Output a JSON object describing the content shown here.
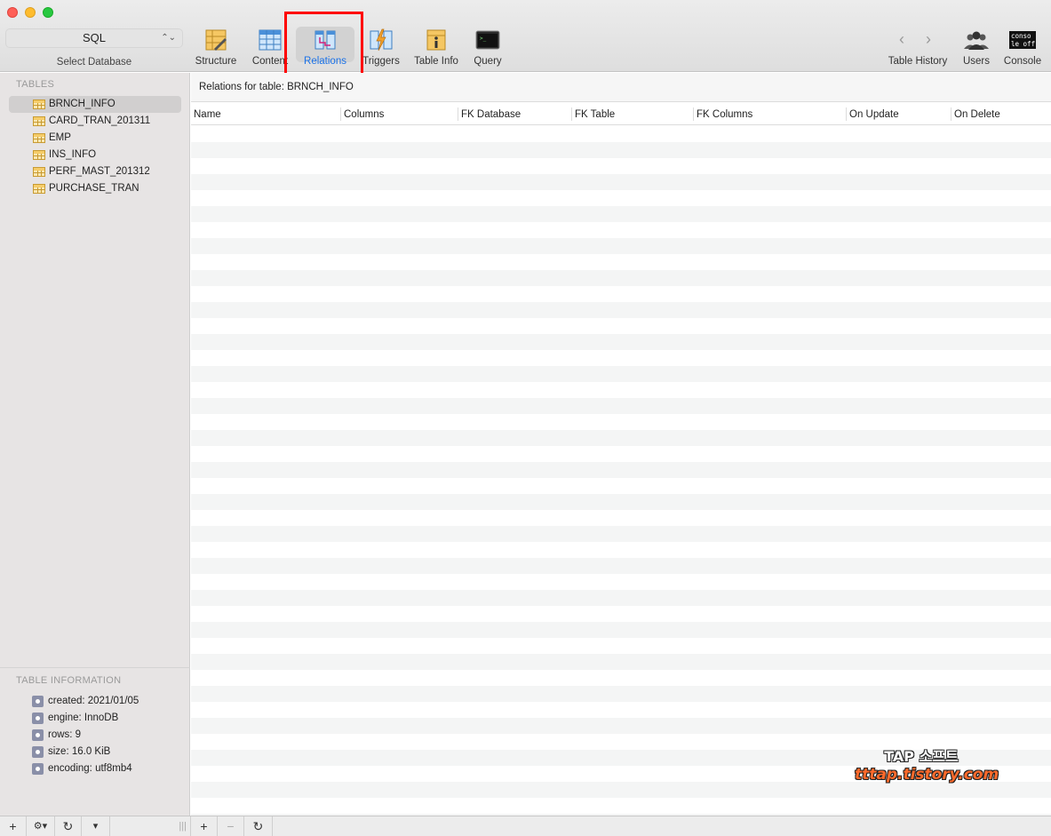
{
  "window": {
    "traffic_lights": [
      "close",
      "minimize",
      "zoom"
    ]
  },
  "toolbar": {
    "database_select_value": "SQL",
    "database_select_caption": "Select Database",
    "items": [
      {
        "label": "Structure",
        "icon": "structure-icon"
      },
      {
        "label": "Content",
        "icon": "content-icon"
      },
      {
        "label": "Relations",
        "icon": "relations-icon",
        "active": true
      },
      {
        "label": "Triggers",
        "icon": "triggers-icon"
      },
      {
        "label": "Table Info",
        "icon": "table-info-icon"
      },
      {
        "label": "Query",
        "icon": "query-icon"
      }
    ],
    "right_items": [
      {
        "label": "Table History",
        "icon": "history-arrows-icon"
      },
      {
        "label": "Users",
        "icon": "users-icon"
      },
      {
        "label": "Console",
        "icon": "console-icon",
        "icon_text_top": "conso",
        "icon_text_bottom": "le off"
      }
    ],
    "accent_color": "#1b72e8",
    "highlight_color": "#ff0000"
  },
  "sidebar": {
    "tables_heading": "TABLES",
    "tables": [
      {
        "name": "BRNCH_INFO",
        "selected": true
      },
      {
        "name": "CARD_TRAN_201311"
      },
      {
        "name": "EMP"
      },
      {
        "name": "INS_INFO"
      },
      {
        "name": "PERF_MAST_201312"
      },
      {
        "name": "PURCHASE_TRAN"
      }
    ],
    "info_heading": "TABLE INFORMATION",
    "info": [
      "created: 2021/01/05",
      "engine: InnoDB",
      "rows: 9",
      "size: 16.0 KiB",
      "encoding: utf8mb4"
    ]
  },
  "main": {
    "caption": "Relations for table: BRNCH_INFO",
    "columns": [
      "Name",
      "Columns",
      "FK Database",
      "FK Table",
      "FK Columns",
      "On Update",
      "On Delete"
    ]
  },
  "watermark": {
    "line1": "TAP 소프트",
    "line2": "tttap.tistory.com"
  },
  "bottom_bar": {
    "left_buttons": [
      "+",
      "⚙▾",
      "↻",
      "▾"
    ],
    "right_buttons": [
      "+",
      "−",
      "↻"
    ]
  }
}
